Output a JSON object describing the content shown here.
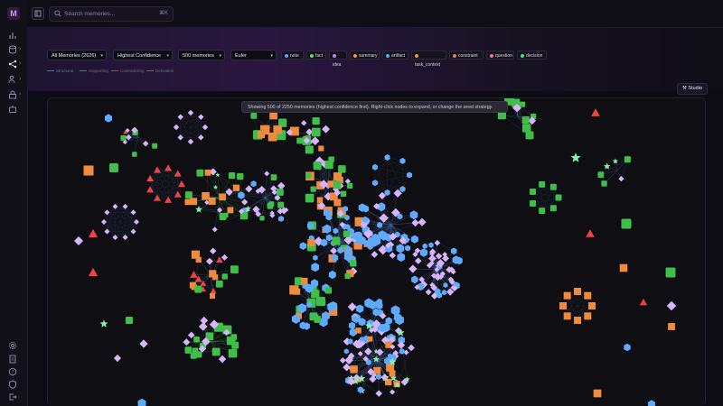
{
  "app": {
    "logo_text": "M"
  },
  "sidebar": {
    "nav": [
      {
        "name": "analytics-icon",
        "expandable": false
      },
      {
        "name": "database-icon",
        "expandable": true
      },
      {
        "name": "graph-icon",
        "expandable": true
      },
      {
        "name": "users-icon",
        "expandable": true
      },
      {
        "name": "lock-icon",
        "expandable": true
      },
      {
        "name": "bot-icon",
        "expandable": false
      }
    ],
    "bottom": [
      "settings-icon",
      "document-icon",
      "help-icon",
      "shield-icon",
      "logout-icon"
    ]
  },
  "header": {
    "search_placeholder": "Search memories...",
    "search_shortcut": "⌘K"
  },
  "filters": {
    "scope": "All Memories (2626)",
    "sort": "Highest Confidence",
    "limit": "500 memories",
    "layout": "Euler",
    "chips": [
      {
        "label": "note",
        "color": "#60a5fa"
      },
      {
        "label": "fact",
        "color": "#4ade80"
      },
      {
        "label": "idea",
        "color": "#c084fc"
      },
      {
        "label": "summary",
        "color": "#fb923c"
      },
      {
        "label": "artifact",
        "color": "#38bdf8"
      },
      {
        "label": "task_context",
        "color": "#fb923c"
      },
      {
        "label": "constraint",
        "color": "#f87171"
      },
      {
        "label": "question",
        "color": "#f472b6"
      },
      {
        "label": "decision",
        "color": "#4ade80"
      }
    ]
  },
  "legend": [
    {
      "label": "Structural",
      "color": "#5b6b9a"
    },
    {
      "label": "Supporting",
      "color": "#4f7f5f"
    },
    {
      "label": "Contradicting",
      "color": "#a04a55"
    },
    {
      "label": "Derivation",
      "color": "#7a6a40"
    }
  ],
  "studio_label": "Studio",
  "tooltip": "Showing 500 of 2250 memories (highest confidence first). Right-click nodes to expand, or change the seed strategy.",
  "colors": {
    "note": "#5eaaff",
    "fact": "#3fbf4a",
    "idea": "#d8b4fe",
    "summary": "#f08a3c",
    "constraint": "#ef4444",
    "decision": "#86efac",
    "edge": "#4a6fa8",
    "edge_support": "#3f8a4a"
  }
}
